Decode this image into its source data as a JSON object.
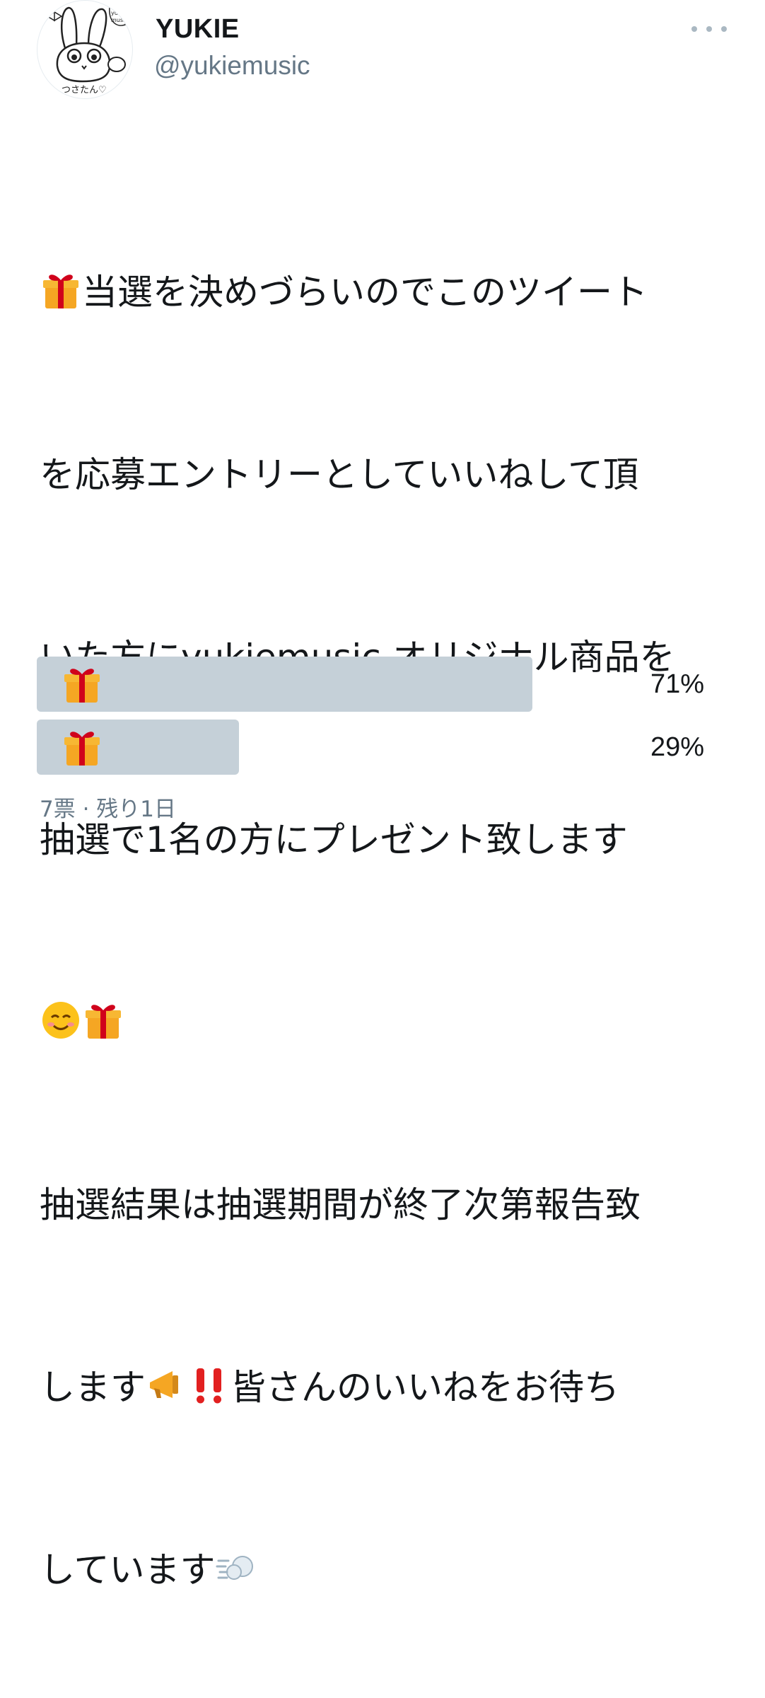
{
  "user": {
    "display_name": "YUKIE",
    "handle": "@yukiemusic",
    "avatar_caption": "つさたん♡",
    "avatar_tag": "yukie music"
  },
  "menu": {
    "more_icon": "more-horizontal-icon"
  },
  "tweet": {
    "lines": [
      [
        "gift",
        "当選を決めづらいのでこのツイート"
      ],
      [
        "text",
        "を応募エントリーとしていいねして頂"
      ],
      [
        "text",
        "いた方にyukiemusic オリジナル商品を"
      ],
      [
        "text",
        "抽選で1名の方にプレゼント致します"
      ],
      [
        "emoji_row",
        ""
      ],
      [
        "text",
        "抽選結果は抽選期間が終了次第報告致"
      ],
      [
        "mixed",
        "します"
      ],
      [
        "dash",
        "しています"
      ]
    ],
    "line7_after": "皆さんのいいねをお待ち",
    "emojis": {
      "gift": "gift-icon",
      "smile": "smiling-face-icon",
      "megaphone": "megaphone-icon",
      "exclaim": "double-exclamation-icon",
      "dash": "dash-icon"
    }
  },
  "poll": {
    "options": [
      {
        "label_icon": "gift-icon",
        "percent_text": "71%",
        "fraction": 0.71,
        "leading": true
      },
      {
        "label_icon": "gift-icon",
        "percent_text": "29%",
        "fraction": 0.29,
        "leading": false
      }
    ],
    "meta": "7票 · 残り1日"
  },
  "colors": {
    "text": "#14171a",
    "secondary": "#657786",
    "poll_bar": "#c5d0d8",
    "gift_box": "#f5a623",
    "gift_ribbon": "#d0021b"
  }
}
